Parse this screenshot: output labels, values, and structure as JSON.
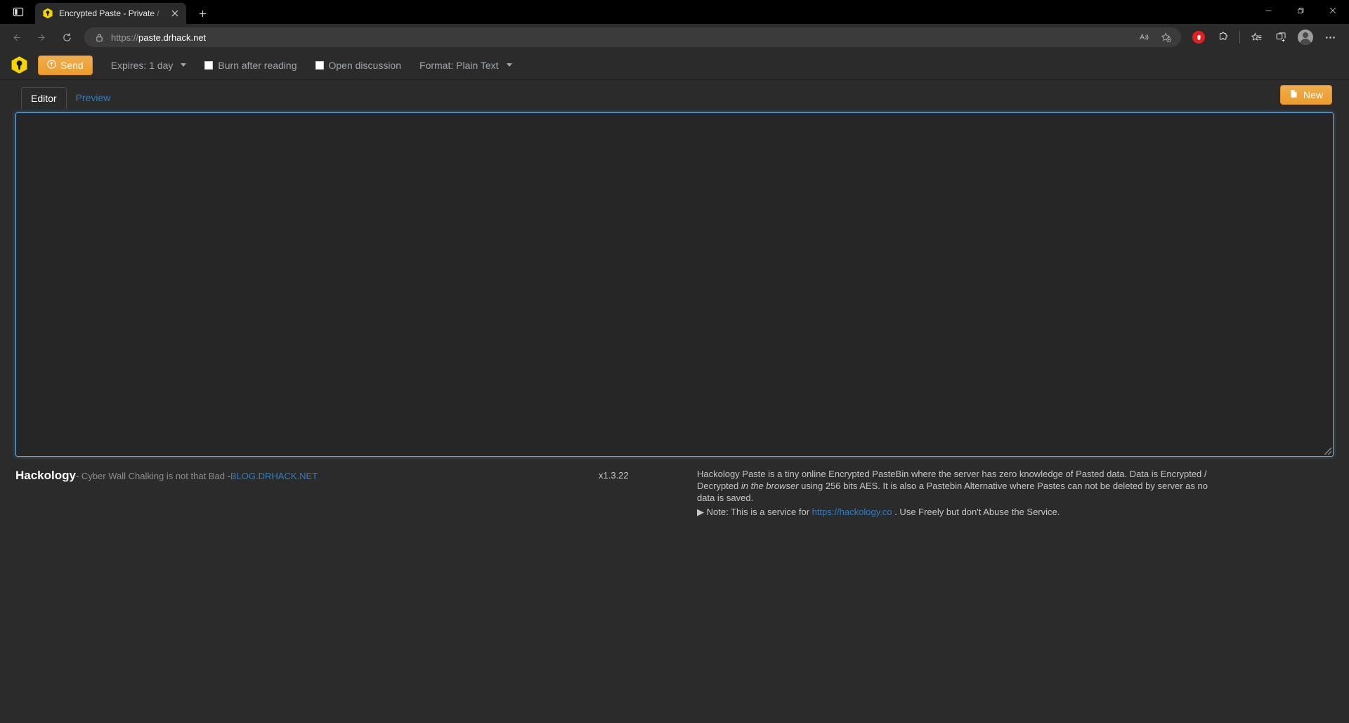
{
  "browser": {
    "tab": {
      "title": "Encrypted Paste - Private / Secur",
      "favicon_icon": "yellow-hexagon-keyhole-icon",
      "close_icon": "close-icon"
    },
    "tabstrip_icon": "tab-search-icon",
    "new_tab_icon": "plus-icon",
    "window_controls": {
      "minimize_icon": "minimize-icon",
      "maximize_icon": "restore-icon",
      "close_icon": "close-icon"
    },
    "nav": {
      "back_icon": "arrow-left-icon",
      "forward_icon": "arrow-right-icon",
      "reload_icon": "reload-icon"
    },
    "omnibox": {
      "lock_icon": "lock-icon",
      "scheme": "https://",
      "host": "paste.drhack.net",
      "read_aloud_icon": "read-aloud-icon",
      "add_favorite_icon": "add-favorite-star-icon"
    },
    "toolbar_right": {
      "adblock_icon": "adblock-hand-icon",
      "extensions_icon": "extensions-puzzle-icon",
      "collections_icon": "collections-star-icon",
      "split_screen_icon": "split-screen-icon",
      "profile_icon": "profile-avatar-icon",
      "settings_icon": "more-options-icon"
    },
    "colors": {
      "chrome_bg": "#000000",
      "navbar_bg": "#2b2b2b",
      "omnibox_bg": "#3b3b3b",
      "adblock_red": "#e12121"
    }
  },
  "app": {
    "logo_icon": "hackology-hexagon-lock-icon",
    "toolbar": {
      "send_label": "Send",
      "send_icon": "upload-circle-icon",
      "expires_label": "Expires: 1 day",
      "expires_caret_icon": "caret-down-icon",
      "burn_label": "Burn after reading",
      "burn_checked": false,
      "discussion_label": "Open discussion",
      "discussion_checked": false,
      "format_label": "Format: Plain Text",
      "format_caret_icon": "caret-down-icon"
    },
    "tabs": [
      {
        "label": "Editor",
        "active": true
      },
      {
        "label": "Preview",
        "active": false
      }
    ],
    "new_button": {
      "label": "New",
      "icon": "new-document-icon"
    },
    "editor": {
      "value": "",
      "placeholder": "",
      "resize_grip_icon": "resize-grip-icon"
    },
    "footer": {
      "brand": "Hackology",
      "tagline": " - Cyber Wall Chalking is not that Bad - ",
      "blog_link": "BLOG.DRHACK.NET",
      "version": "x1.3.22",
      "description_1": "Hackology Paste is a tiny online Encrypted PasteBin where the server has zero knowledge of Pasted data. Data is Encrypted / Decrypted ",
      "description_italic": "in the browser",
      "description_2": " using 256 bits AES. It is also a Pastebin Alternative where Pastes can not be deleted by server as no data is saved.",
      "note_bullet": "▶",
      "note_prefix": " Note: This is a service for ",
      "note_link": "https://hackology.co",
      "note_suffix": " . Use Freely but don't Abuse the Service."
    },
    "colors": {
      "page_bg": "#2b2b2b",
      "accent_orange": "#f0ad4e",
      "link_blue": "#2a7fc9",
      "editor_border": "#66afe9",
      "logo_yellow": "#f5d400"
    }
  }
}
